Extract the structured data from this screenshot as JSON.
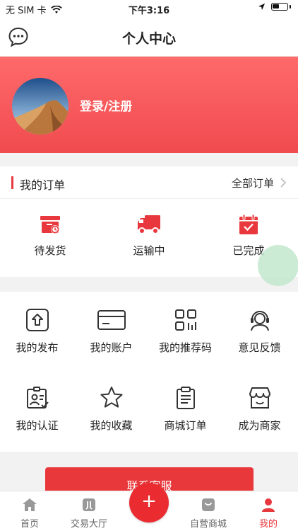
{
  "status_bar": {
    "carrier": "无 SIM 卡",
    "time": "下午3:16"
  },
  "nav": {
    "title": "个人中心",
    "icons": {
      "chat": "chat-bubble-icon"
    }
  },
  "profile": {
    "login_label": "登录/注册"
  },
  "orders": {
    "title": "我的订单",
    "all_label": "全部订单",
    "items": [
      {
        "label": "待发货",
        "icon": "pending-ship-icon"
      },
      {
        "label": "运输中",
        "icon": "truck-icon"
      },
      {
        "label": "已完成",
        "icon": "calendar-check-icon"
      }
    ]
  },
  "services": [
    {
      "label": "我的发布",
      "icon": "publish-icon"
    },
    {
      "label": "我的账户",
      "icon": "card-icon"
    },
    {
      "label": "我的推荐码",
      "icon": "qrcode-icon"
    },
    {
      "label": "意见反馈",
      "icon": "headset-icon"
    },
    {
      "label": "我的认证",
      "icon": "id-card-icon"
    },
    {
      "label": "我的收藏",
      "icon": "star-icon"
    },
    {
      "label": "商城订单",
      "icon": "clipboard-icon"
    },
    {
      "label": "成为商家",
      "icon": "store-icon"
    }
  ],
  "contact_label": "联系客服",
  "tabs": [
    {
      "label": "首页",
      "icon": "home-icon"
    },
    {
      "label": "交易大厅",
      "icon": "trade-hall-icon"
    },
    {
      "label": "自营商城",
      "icon": "shopping-bag-icon"
    },
    {
      "label": "我的",
      "icon": "person-icon",
      "active": true
    }
  ],
  "colors": {
    "accent": "#e8383d",
    "hero_top": "#ff6a6a",
    "hero_bottom": "#f04b4f"
  }
}
